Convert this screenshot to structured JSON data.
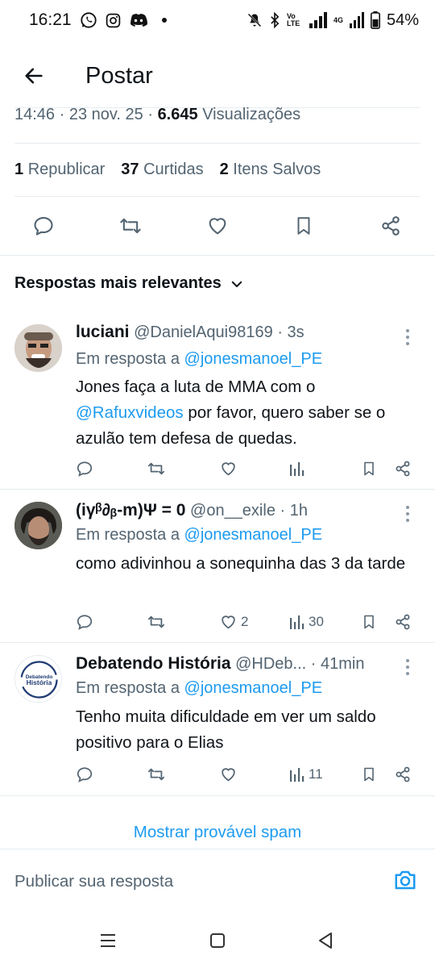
{
  "status_bar": {
    "time": "16:21",
    "battery": "54%",
    "volte": "Vo LTE",
    "network": "4G"
  },
  "appbar": {
    "title": "Postar"
  },
  "post_meta": {
    "time": "14:46",
    "date": "23 nov. 25",
    "views_count": "6.645",
    "views_label": "Visualizações"
  },
  "post_stats": {
    "reposts_count": "1",
    "reposts_label": "Republicar",
    "likes_count": "37",
    "likes_label": "Curtidas",
    "saves_count": "2",
    "saves_label": "Itens Salvos"
  },
  "sort": {
    "label": "Respostas mais relevantes"
  },
  "replies": [
    {
      "name": "luciani",
      "handle": "@DanielAqui98169",
      "time": "3s",
      "reply_prefix": "Em resposta a",
      "reply_to": "@jonesmanoel_PE",
      "text_part1": "Jones faça a luta de MMA com o",
      "mention": "@Rafuxvideos",
      "text_part2": "por favor, quero saber se o azulão tem defesa de quedas.",
      "likes": "",
      "views": ""
    },
    {
      "name": "(iγᵝ∂ᵦ-m)Ψ = 0",
      "handle": "@on__exile",
      "time": "1h",
      "reply_prefix": "Em resposta a",
      "reply_to": "@jonesmanoel_PE",
      "text": "como adivinhou a sonequinha das 3 da tarde",
      "likes": "2",
      "views": "30"
    },
    {
      "name": "Debatendo História",
      "handle": "@HDeb...",
      "time": "41min",
      "reply_prefix": "Em resposta a",
      "reply_to": "@jonesmanoel_PE",
      "text": "Tenho muita dificuldade em ver um saldo positivo para o Elias",
      "avatar_text_top": "Debatendo",
      "avatar_text_bottom": "História",
      "likes": "",
      "views": "11"
    }
  ],
  "spam_link": "Mostrar provável spam",
  "composer": {
    "placeholder": "Publicar sua resposta"
  },
  "colors": {
    "accent": "#1d9bf0",
    "text": "#0f1419",
    "secondary": "#536471",
    "divider": "#e6ecf0"
  }
}
